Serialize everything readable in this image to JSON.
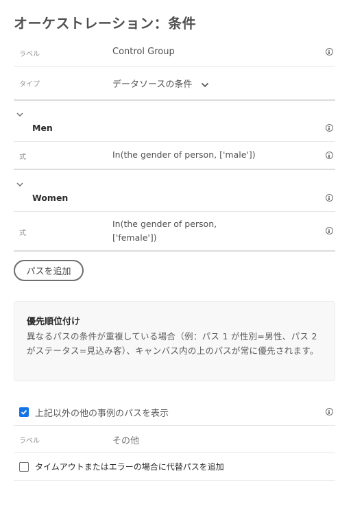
{
  "page": {
    "title": "オーケストレーション：条件"
  },
  "fields": {
    "label_caption": "ラベル",
    "label_value": "Control Group",
    "type_caption": "タイプ",
    "type_value": "データソースの条件"
  },
  "paths": [
    {
      "name": "Men",
      "expr_caption": "式",
      "expr_line1": "In(the gender of person, ['male'])",
      "expr_line2": ""
    },
    {
      "name": "Women",
      "expr_caption": "式",
      "expr_line1": "In(the gender of person,",
      "expr_line2": "['female'])"
    }
  ],
  "add_path_label": "パスを追加",
  "priority": {
    "title": "優先順位付け",
    "text": "異なるパスの条件が重複している場合（例：パス 1 が性別=男性、パス 2 がステータス=見込み客）、キャンバス内の上のパスが常に優先されます。"
  },
  "other_paths": {
    "checkbox_label": "上記以外の他の事例のパスを表示",
    "checked": true,
    "label_caption": "ラベル",
    "label_value": "その他"
  },
  "timeout": {
    "checkbox_label": "タイムアウトまたはエラーの場合に代替パスを追加",
    "checked": false
  },
  "colors": {
    "accent": "#1473e6",
    "text": "#4b4b4b",
    "divider": "#e6e6e6"
  }
}
